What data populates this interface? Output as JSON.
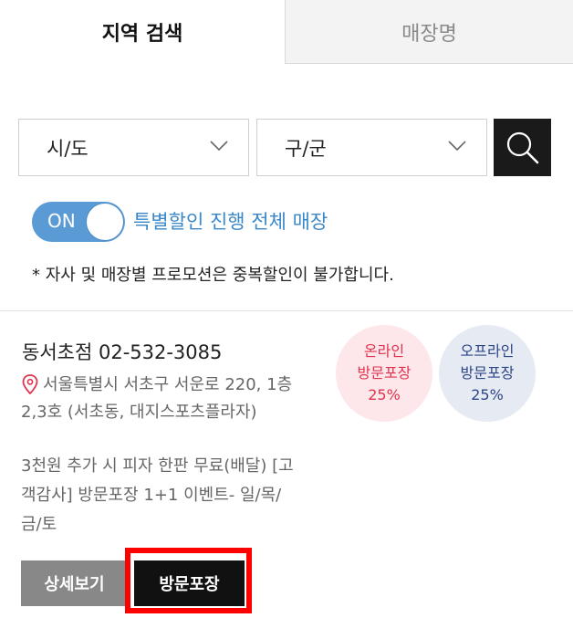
{
  "tabs": [
    {
      "label": "지역 검색",
      "active": true
    },
    {
      "label": "매장명",
      "active": false
    }
  ],
  "filters": {
    "city": {
      "value": "시/도"
    },
    "district": {
      "value": "구/군"
    }
  },
  "toggle": {
    "state_label": "ON",
    "on": true,
    "label": "특별할인 진행 전체 매장"
  },
  "notice": "* 자사 및 매장별 프로모션은 중복할인이 불가합니다.",
  "store": {
    "name": "동서초점",
    "phone": "02-532-3085",
    "address": "서울특별시 서초구 서운로 220, 1층 2,3호 (서초동, 대지스포츠플라자)",
    "promotions": "3천원 추가 시 피자 한판 무료(배달) [고객감사] 방문포장 1+1 이벤트- 일/목/금/토",
    "badges": {
      "online": {
        "line1": "온라인",
        "line2": "방문포장",
        "line3": "25%"
      },
      "offline": {
        "line1": "오프라인",
        "line2": "방문포장",
        "line3": "25%"
      }
    },
    "buttons": {
      "detail": "상세보기",
      "takeout": "방문포장"
    }
  },
  "colors": {
    "toggle_on": "#5b9bd5",
    "toggle_label": "#3a87c8",
    "online_badge_bg": "#fde7ea",
    "online_badge_text": "#e0334e",
    "offline_badge_bg": "#e5eaf3",
    "offline_badge_text": "#2e4585",
    "highlight": "#ff0000"
  },
  "icons": {
    "search": "search-icon",
    "chevron": "chevron-down-icon",
    "location": "location-pin-icon"
  }
}
